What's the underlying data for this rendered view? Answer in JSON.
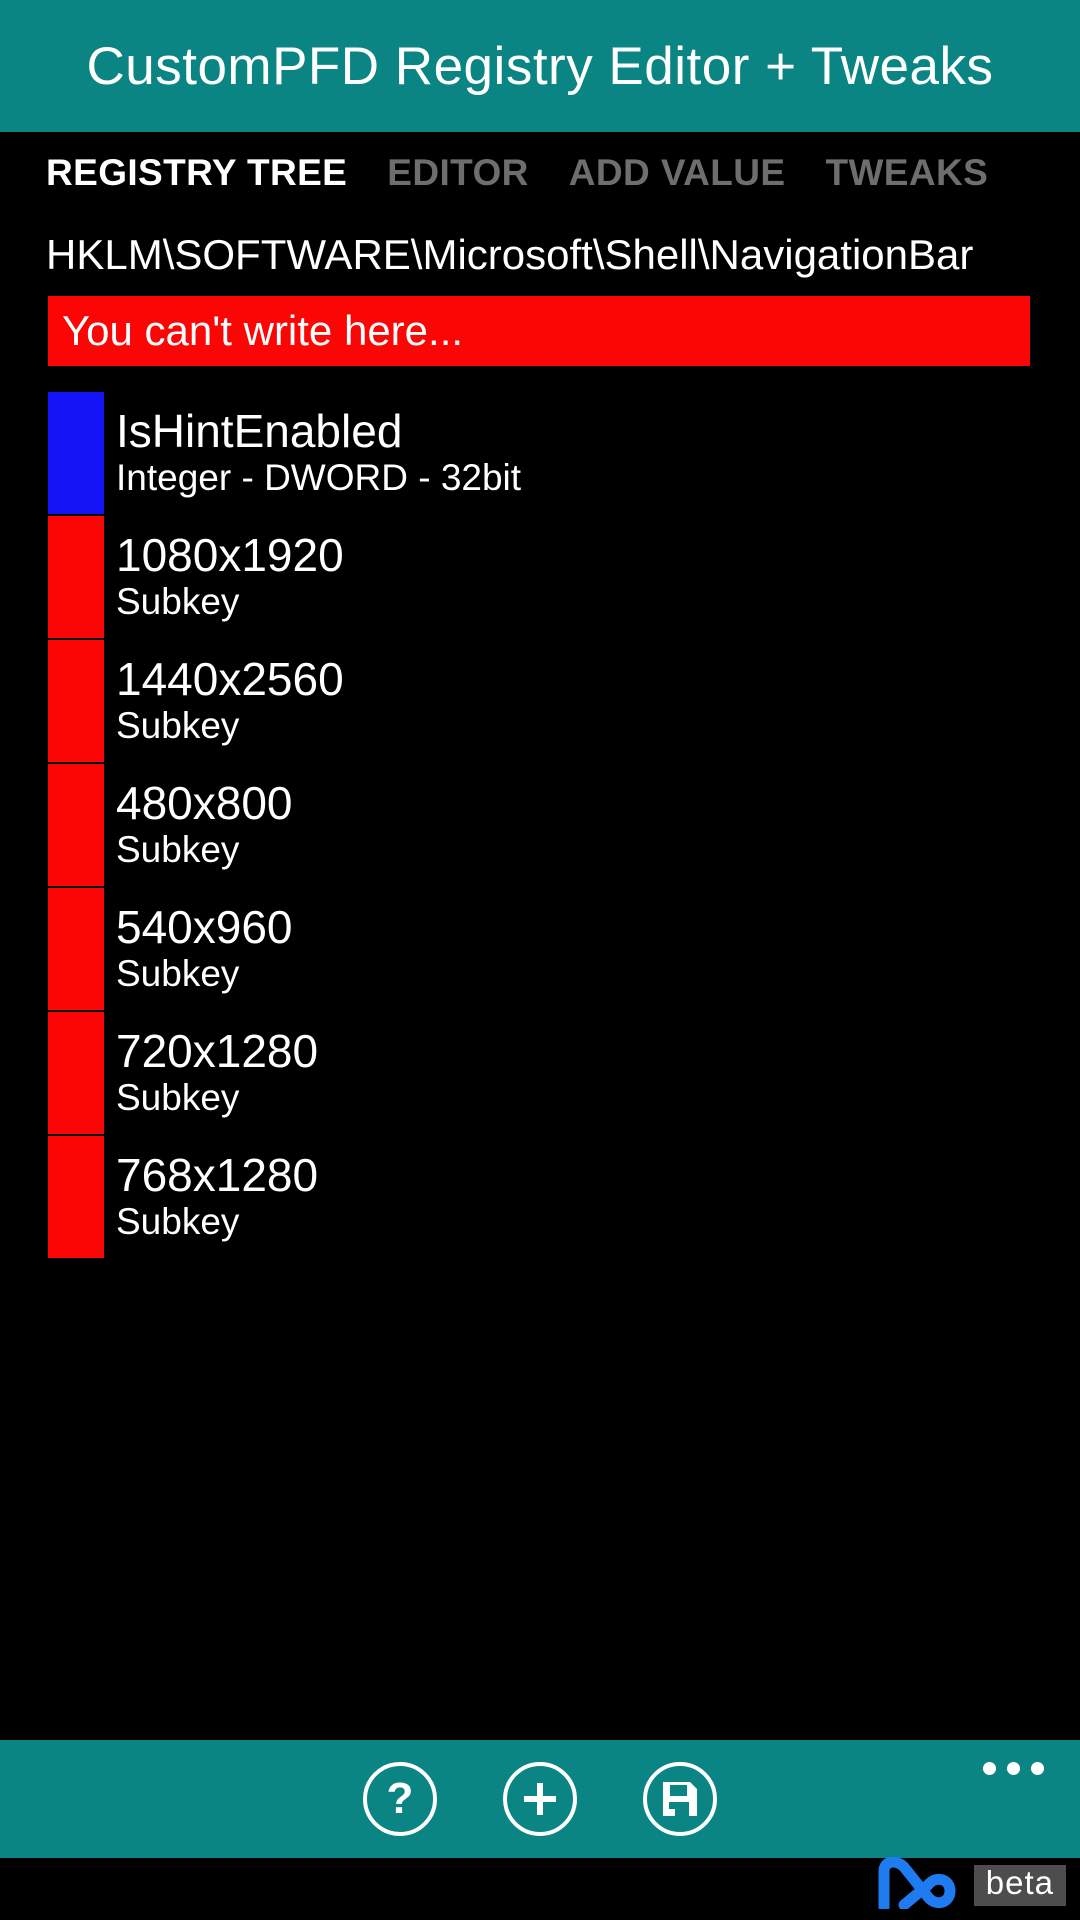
{
  "window": {
    "title": "CustomPFD Registry Editor + Tweaks",
    "accent_color": "#0A8584",
    "background_color": "#000000",
    "error_color": "#FB0505",
    "value_marker_color": "#1313F5",
    "subkey_marker_color": "#FB0505"
  },
  "pivot": {
    "tabs": [
      {
        "label": "REGISTRY TREE",
        "active": true
      },
      {
        "label": "EDITOR",
        "active": false
      },
      {
        "label": "ADD VALUE",
        "active": false
      },
      {
        "label": "TWEAKS",
        "active": false
      }
    ]
  },
  "path": {
    "value": "HKLM\\SOFTWARE\\Microsoft\\Shell\\NavigationBar"
  },
  "banner": {
    "message": "You can't write here..."
  },
  "tree": {
    "items": [
      {
        "name": "IsHintEnabled",
        "type": "Integer - DWORD - 32bit",
        "marker": "blue"
      },
      {
        "name": "1080x1920",
        "type": "Subkey",
        "marker": "red"
      },
      {
        "name": "1440x2560",
        "type": "Subkey",
        "marker": "red"
      },
      {
        "name": "480x800",
        "type": "Subkey",
        "marker": "red"
      },
      {
        "name": "540x960",
        "type": "Subkey",
        "marker": "red"
      },
      {
        "name": "720x1280",
        "type": "Subkey",
        "marker": "red"
      },
      {
        "name": "768x1280",
        "type": "Subkey",
        "marker": "red"
      }
    ]
  },
  "appbar": {
    "buttons": [
      {
        "icon": "question-mark-icon",
        "name": "help"
      },
      {
        "icon": "plus-icon",
        "name": "add"
      },
      {
        "icon": "floppy-disk-icon",
        "name": "save"
      }
    ],
    "overflow_label": "…",
    "help_glyph": "?"
  },
  "watermark": {
    "badge": "beta",
    "logo": "pc-logo"
  }
}
